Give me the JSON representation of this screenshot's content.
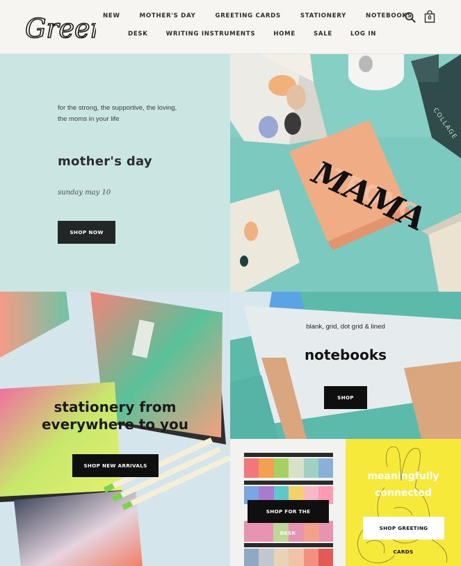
{
  "brand": {
    "logo_text": "Greer"
  },
  "nav": {
    "row1": [
      "NEW",
      "MOTHER'S DAY",
      "GREETING CARDS",
      "STATIONERY",
      "NOTEBOOKS"
    ],
    "row2": [
      "DESK",
      "WRITING INSTRUMENTS",
      "HOME",
      "SALE",
      "LOG IN"
    ],
    "cart_count": "0",
    "icons": [
      "search-icon",
      "cart-icon"
    ]
  },
  "hero": {
    "tagline": "for the strong, the supportive, the loving, the moms in your life",
    "title": "mother's day",
    "date": "sunday may 10",
    "button": "SHOP NOW",
    "image_text": "MAMA",
    "colors": {
      "panel": "#c9e6e3",
      "button": "#212626"
    }
  },
  "stationery": {
    "title_line1": "stationery from",
    "title_line2": "everywhere to you",
    "button": "SHOP NEW ARRIVALS"
  },
  "notebooks": {
    "subtitle": "blank, grid, dot grid & lined",
    "title": "notebooks",
    "button": "SHOP"
  },
  "desk": {
    "button_line1": "SHOP FOR THE",
    "button_line2": "DESK"
  },
  "cards": {
    "title_line1": "meaningfully",
    "title_line2": "connected",
    "button_line1": "SHOP GREETING",
    "button_line2": "CARDS",
    "colors": {
      "panel": "#f7e93a"
    }
  }
}
